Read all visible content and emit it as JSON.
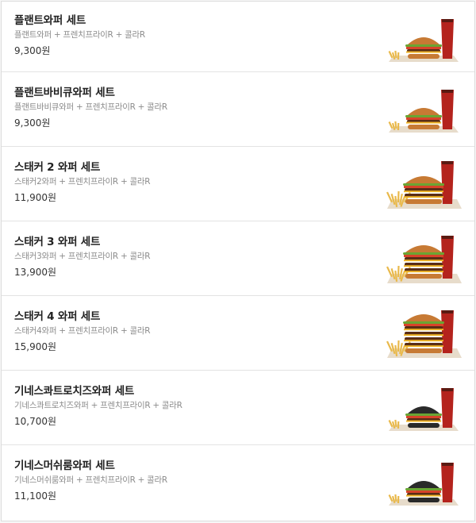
{
  "menu": {
    "items": [
      {
        "name": "플랜트와퍼 세트",
        "description": "플랜트와퍼 + 프렌치프라이R + 콜라R",
        "price": "9,300원",
        "image": "plant-whopper-set-burger-image",
        "bun_color": "#c77a34"
      },
      {
        "name": "플랜트바비큐와퍼 세트",
        "description": "플랜트바비큐와퍼 + 프렌치프라이R + 콜라R",
        "price": "9,300원",
        "image": "plant-bbq-whopper-set-burger-image",
        "bun_color": "#c77a34"
      },
      {
        "name": "스태커 2 와퍼 세트",
        "description": "스태커2와퍼 + 프렌치프라이R + 콜라R",
        "price": "11,900원",
        "image": "stacker-2-whopper-set-burger-image",
        "bun_color": "#c77a34"
      },
      {
        "name": "스태커 3 와퍼 세트",
        "description": "스태커3와퍼 + 프렌치프라이R + 콜라R",
        "price": "13,900원",
        "image": "stacker-3-whopper-set-burger-image",
        "bun_color": "#c77a34"
      },
      {
        "name": "스태커 4 와퍼 세트",
        "description": "스태커4와퍼 + 프렌치프라이R + 콜라R",
        "price": "15,900원",
        "image": "stacker-4-whopper-set-burger-image",
        "bun_color": "#c77a34"
      },
      {
        "name": "기네스콰트로치즈와퍼 세트",
        "description": "기네스콰트로치즈와퍼 + 프렌치프라이R + 콜라R",
        "price": "10,700원",
        "image": "guinness-quattro-cheese-whopper-set-burger-image",
        "bun_color": "#2a2a2a"
      },
      {
        "name": "기네스머쉬룸와퍼 세트",
        "description": "기네스머쉬룸와퍼 + 프렌치프라이R + 콜라R",
        "price": "11,100원",
        "image": "guinness-mushroom-whopper-set-burger-image",
        "bun_color": "#2a2a2a"
      }
    ]
  },
  "colors": {
    "patty": "#5a2d15",
    "lettuce": "#6aa533",
    "tomato": "#d8432a",
    "cheese": "#f1b526",
    "cola": "#5a1a12",
    "cup": "#b4231d",
    "fries": "#e9b94b",
    "tray": "#e7dccb"
  }
}
